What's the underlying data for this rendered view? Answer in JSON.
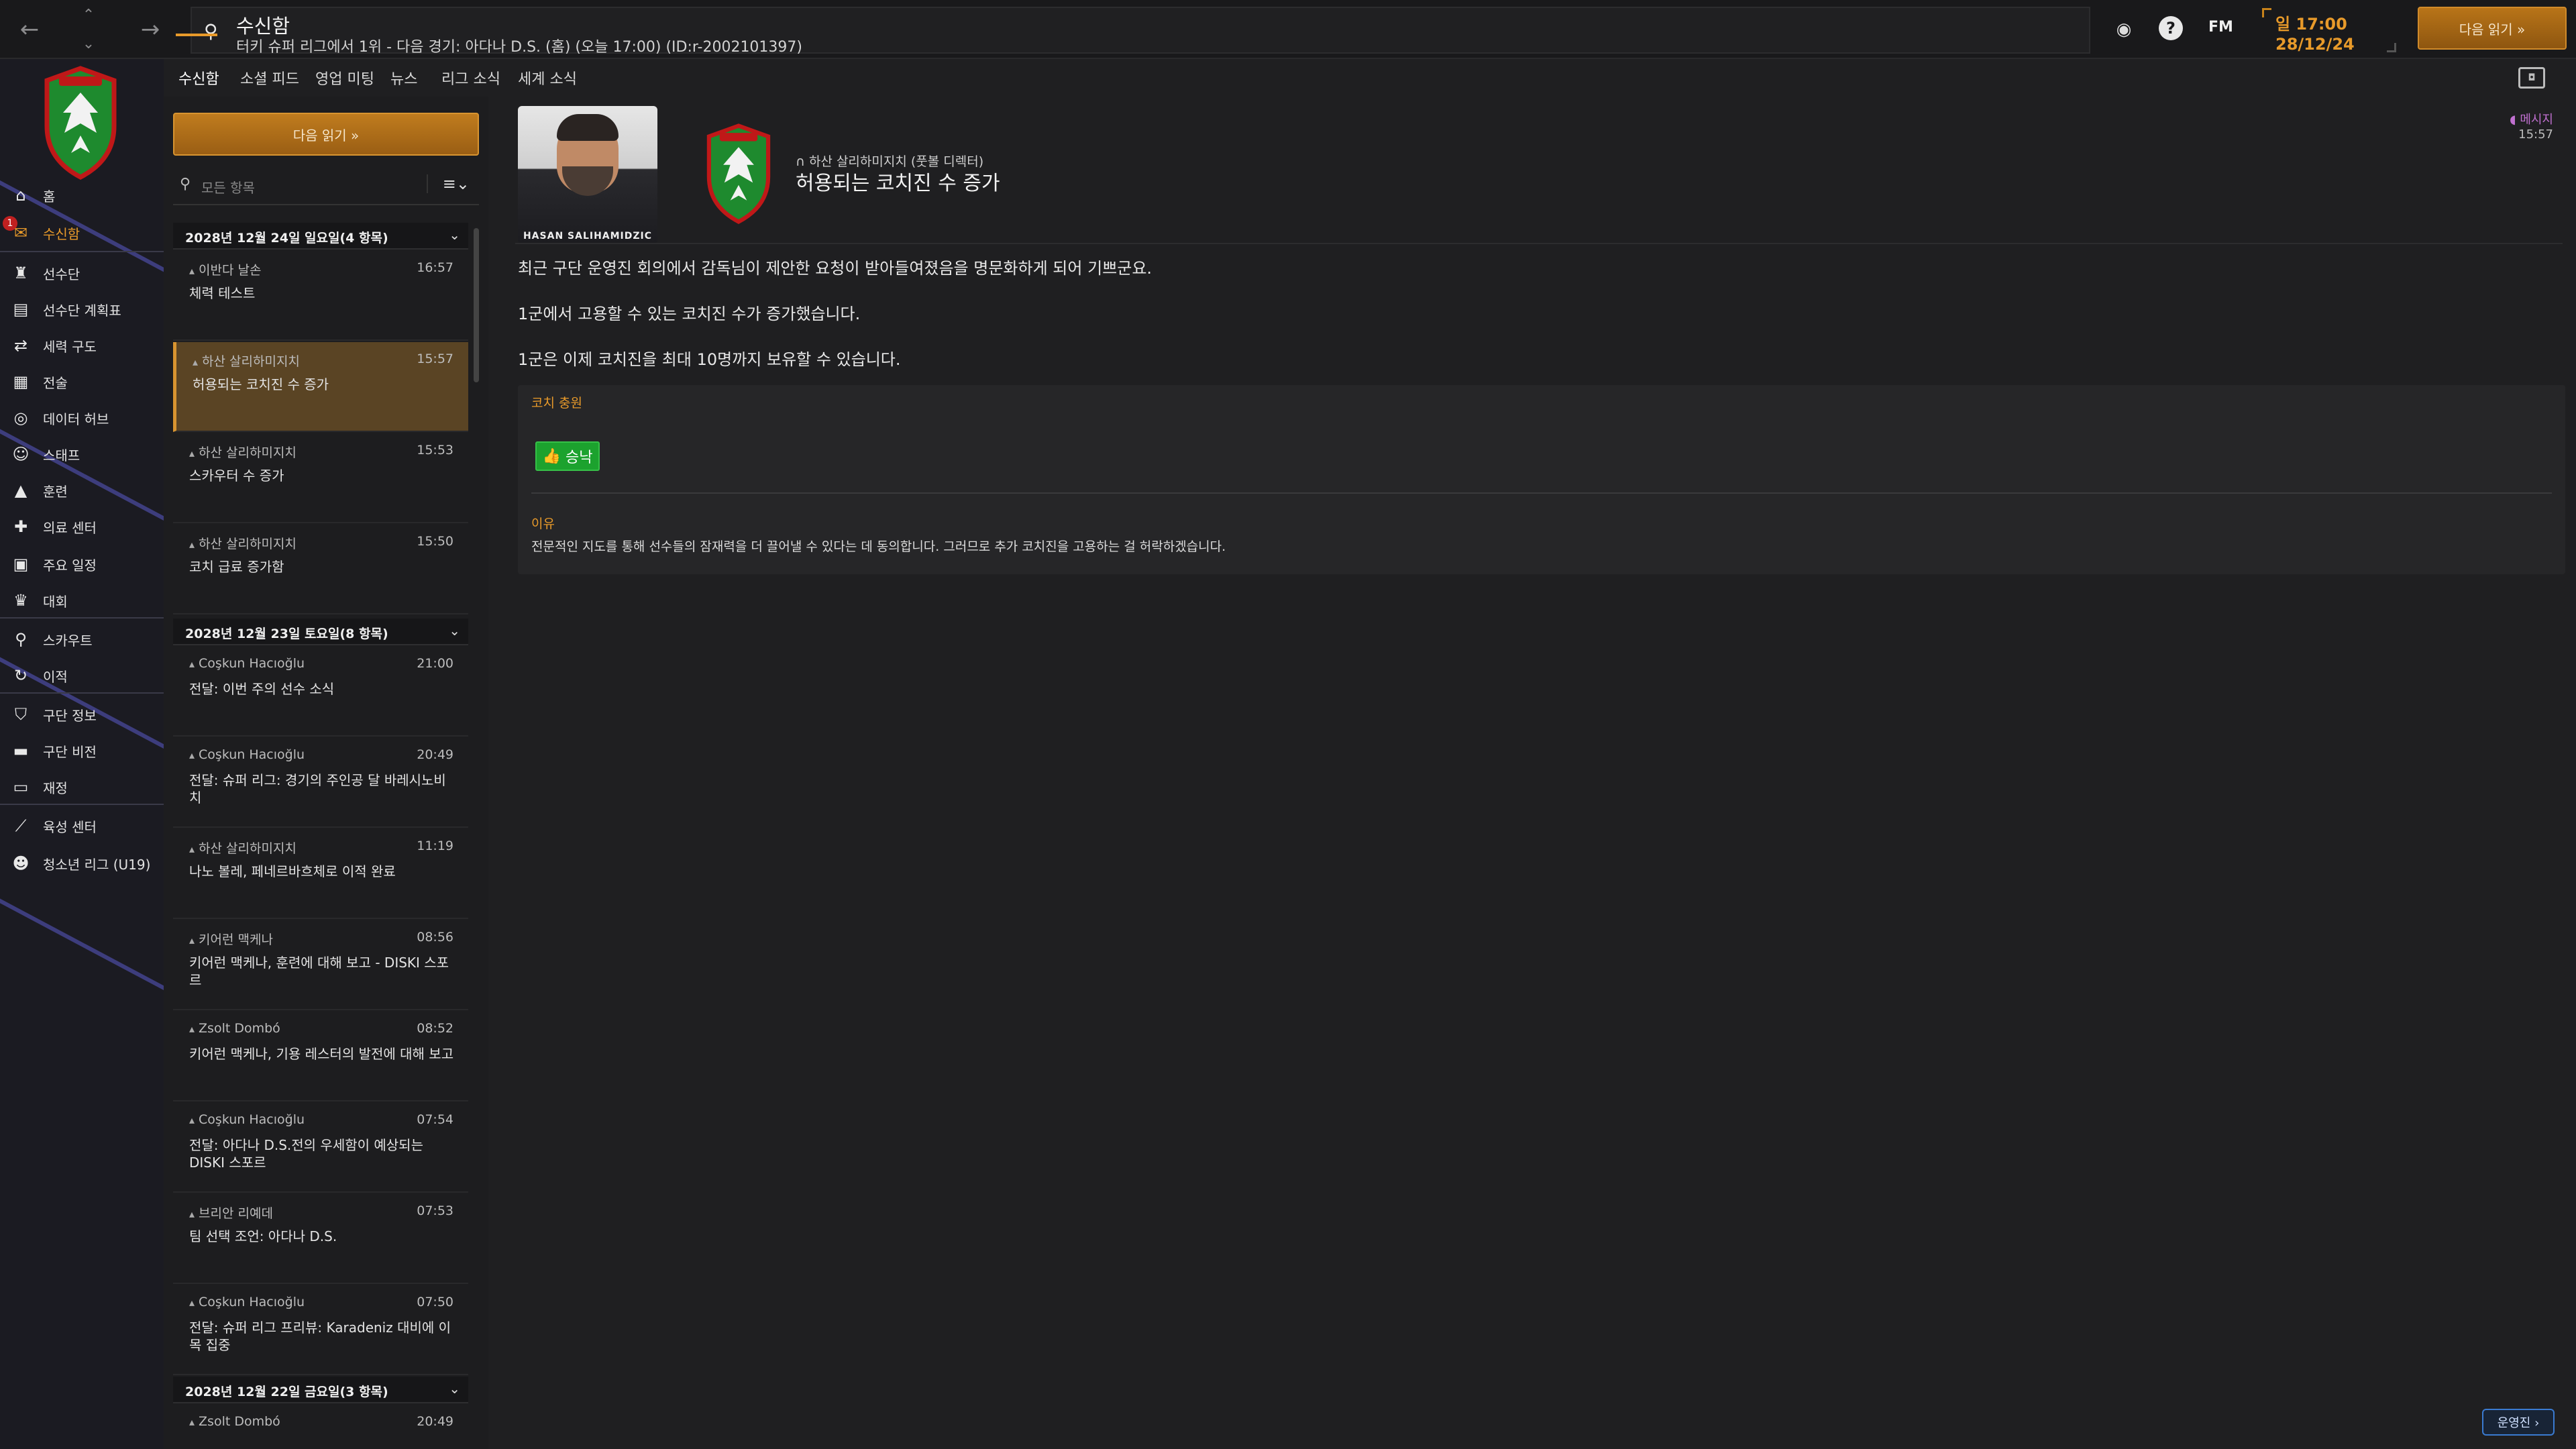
{
  "topbar": {
    "back_icon": "arrow-left-icon",
    "forward_icon": "arrow-right-icon",
    "search_icon": "search-icon",
    "title": "수신함",
    "subtitle": "터키 슈퍼 리그에서 1위 - 다음 경기: 아다나 D.S. (홈) (오늘 17:00) (ID:r-2002101397)",
    "fm_label": "FM",
    "time": "일 17:00",
    "date": "28/12/24",
    "continue_label": "다음 읽기 »"
  },
  "sidebar": {
    "items": [
      {
        "label": "홈",
        "icon": "home-icon"
      },
      {
        "label": "수신함",
        "icon": "inbox-icon",
        "badge": "1",
        "active": true
      },
      {
        "label": "선수단",
        "icon": "shirt-icon"
      },
      {
        "label": "선수단 계획표",
        "icon": "clipboard-icon"
      },
      {
        "label": "세력 구도",
        "icon": "dynamics-icon"
      },
      {
        "label": "전술",
        "icon": "tactics-icon"
      },
      {
        "label": "데이터 허브",
        "icon": "data-hub-icon"
      },
      {
        "label": "스태프",
        "icon": "staff-icon"
      },
      {
        "label": "훈련",
        "icon": "training-icon"
      },
      {
        "label": "의료 센터",
        "icon": "medical-icon"
      },
      {
        "label": "주요 일정",
        "icon": "calendar-icon"
      },
      {
        "label": "대회",
        "icon": "trophy-icon"
      },
      {
        "label": "스카우트",
        "icon": "scout-icon"
      },
      {
        "label": "이적",
        "icon": "transfer-icon"
      },
      {
        "label": "구단 정보",
        "icon": "club-info-icon"
      },
      {
        "label": "구단 비전",
        "icon": "club-vision-icon"
      },
      {
        "label": "재정",
        "icon": "finance-icon"
      },
      {
        "label": "육성 센터",
        "icon": "development-icon"
      },
      {
        "label": "청소년 리그 (U19)",
        "icon": "youth-icon"
      }
    ]
  },
  "tabs": [
    "수신함",
    "소셜 피드",
    "영업 미팅",
    "뉴스",
    "리그 소식",
    "세계 소식"
  ],
  "inbox": {
    "continue_label": "다음 읽기 »",
    "filter_placeholder": "모든 항목",
    "groups": [
      {
        "header": "2028년 12월 24일 일요일(4 항목)"
      },
      {
        "header": "2028년 12월 23일 토요일(8 항목)"
      },
      {
        "header": "2028년 12월 22일 금요일(3 항목)"
      }
    ],
    "messages": [
      {
        "sender": "이반다 날손",
        "time": "16:57",
        "subject": "체력 테스트"
      },
      {
        "sender": "하산 살리하미지치",
        "time": "15:57",
        "subject": "허용되는 코치진 수 증가"
      },
      {
        "sender": "하산 살리하미지치",
        "time": "15:53",
        "subject": "스카우터 수 증가"
      },
      {
        "sender": "하산 살리하미지치",
        "time": "15:50",
        "subject": "코치 급료 증가함"
      },
      {
        "sender": "Coşkun Hacıoğlu",
        "time": "21:00",
        "subject": "전달: 이번 주의 선수 소식"
      },
      {
        "sender": "Coşkun Hacıoğlu",
        "time": "20:49",
        "subject": "전달: 슈퍼 리그: 경기의 주인공 달 바레시노비치"
      },
      {
        "sender": "하산 살리하미지치",
        "time": "11:19",
        "subject": "나노 볼레, 페네르바흐체로 이적 완료"
      },
      {
        "sender": "키어런 맥케나",
        "time": "08:56",
        "subject": "키어런 맥케나, 훈련에 대해 보고 - DISKI 스포르"
      },
      {
        "sender": "Zsolt Dombó",
        "time": "08:52",
        "subject": "키어런 맥케나, 기용 레스터의 발전에 대해 보고"
      },
      {
        "sender": "Coşkun Hacıoğlu",
        "time": "07:54",
        "subject": "전달: 아다나 D.S.전의 우세함이 예상되는 DISKI 스포르"
      },
      {
        "sender": "브리안 리예데",
        "time": "07:53",
        "subject": "팀 선택 조언: 아다나 D.S."
      },
      {
        "sender": "Coşkun Hacıoğlu",
        "time": "07:50",
        "subject": "전달: 슈퍼 리그 프리뷰: Karadeniz 대비에 이목 집중"
      },
      {
        "sender": "Zsolt Dombó",
        "time": "20:49",
        "subject": ""
      }
    ]
  },
  "detail": {
    "photo_caption": "HASAN SALIHAMIDZIC",
    "from": "하산 살리하미지치 (풋볼 디렉터)",
    "headline": "허용되는 코치진 수 증가",
    "tag": "메시지",
    "time": "15:57",
    "paragraphs": [
      "최근 구단 운영진 회의에서 감독님이 제안한 요청이 받아들여졌음을 명문화하게 되어 기쁘군요.",
      "1군에서 고용할 수 있는 코치진 수가 증가했습니다.",
      "1군은 이제 코치진을 최대 10명까지 보유할 수 있습니다."
    ],
    "section_label": "코치 충원",
    "approve_label": "승낙",
    "reason_label": "이유",
    "reason_text": "전문적인 지도를 통해 선수들의 잠재력을 더 끌어낼 수 있다는 데 동의합니다. 그러므로 추가 코치진을 고용하는 걸 허락하겠습니다."
  },
  "bottom_button_label": "운영진 ›",
  "colors": {
    "accent": "#e89a2a",
    "approve": "#1ca22e",
    "selected_row": "#5a4424"
  }
}
